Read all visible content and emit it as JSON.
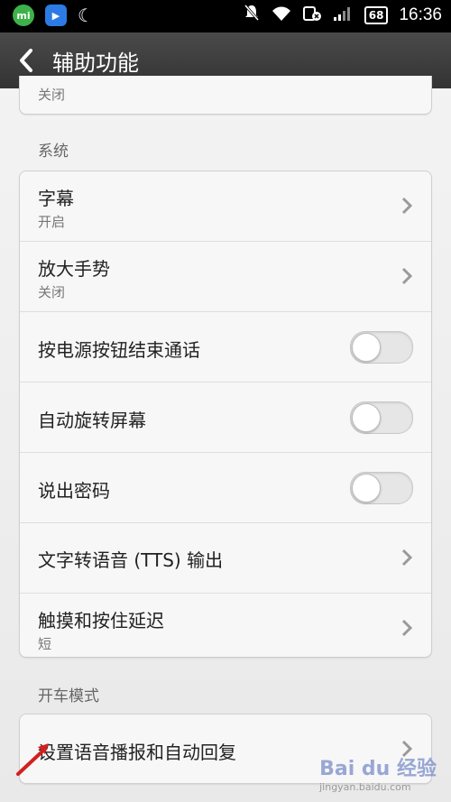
{
  "status_bar": {
    "time": "16:36",
    "battery": "68",
    "app_icon_1": "mi",
    "app_icon_2": "▶"
  },
  "header": {
    "title": "辅助功能"
  },
  "top_card": {
    "sub": "关闭"
  },
  "sections": {
    "system": "系统",
    "driving": "开车模式"
  },
  "system_items": [
    {
      "title": "字幕",
      "sub": "开启"
    },
    {
      "title": "放大手势",
      "sub": "关闭"
    },
    {
      "title": "按电源按钮结束通话"
    },
    {
      "title": "自动旋转屏幕"
    },
    {
      "title": "说出密码"
    },
    {
      "title": "文字转语音 (TTS) 输出"
    },
    {
      "title": "触摸和按住延迟",
      "sub": "短"
    }
  ],
  "driving_items": [
    {
      "title": "设置语音播报和自动回复"
    }
  ],
  "watermark": {
    "logo": "Bai du 经验",
    "sub": "jingyan.baidu.com"
  },
  "colors": {
    "header_bg": "#3a3a3a",
    "arrow": "#d22020"
  }
}
